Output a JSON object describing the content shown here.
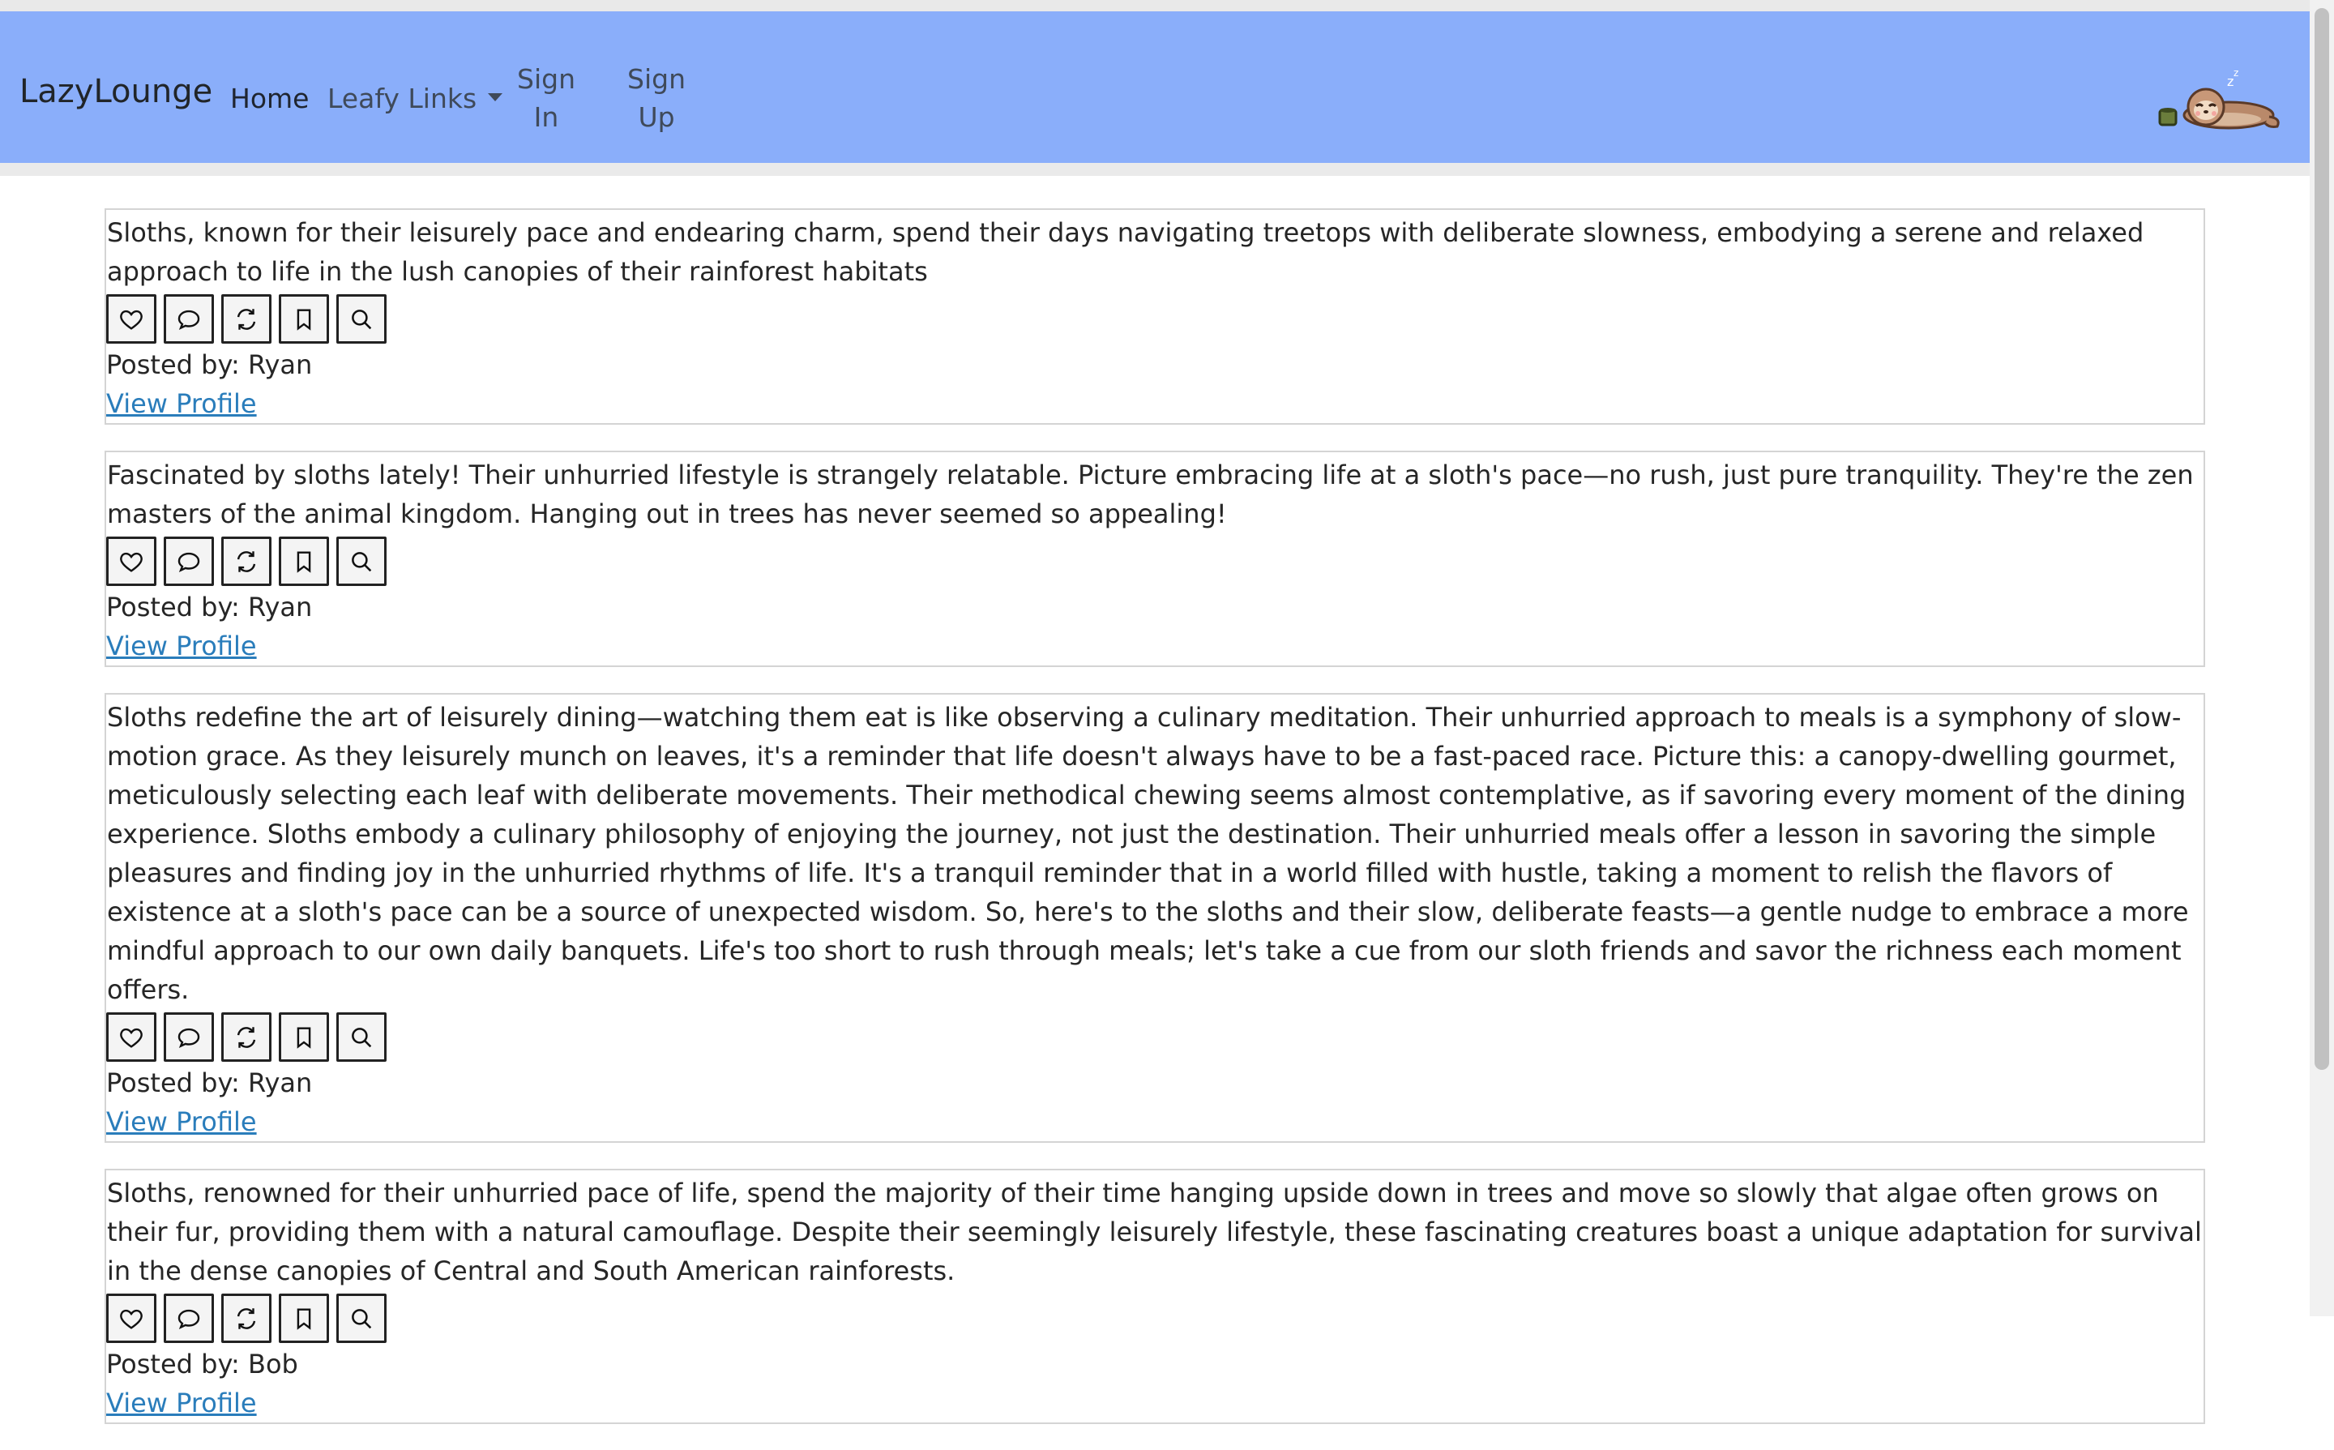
{
  "navbar": {
    "brand": "LazyLounge",
    "links": {
      "home": "Home",
      "leafy": "Leafy Links",
      "sign_in": "Sign In",
      "sign_up": "Sign Up"
    },
    "bg_color": "#8aaefa",
    "logo_icon": "sleeping-sloth-icon"
  },
  "action_icons": [
    "heart-icon",
    "comment-icon",
    "repost-icon",
    "bookmark-icon",
    "search-icon"
  ],
  "posts": [
    {
      "text": "Sloths, known for their leisurely pace and endearing charm, spend their days navigating treetops with deliberate slowness, embodying a serene and relaxed approach to life in the lush canopies of their rainforest habitats",
      "posted_by": "Posted by: Ryan",
      "link": "View Profile"
    },
    {
      "text": "Fascinated by sloths lately! Their unhurried lifestyle is strangely relatable. Picture embracing life at a sloth's pace—no rush, just pure tranquility. They're the zen masters of the animal kingdom. Hanging out in trees has never seemed so appealing!",
      "posted_by": "Posted by: Ryan",
      "link": "View Profile"
    },
    {
      "text": "Sloths redefine the art of leisurely dining—watching them eat is like observing a culinary meditation. Their unhurried approach to meals is a symphony of slow-motion grace. As they leisurely munch on leaves, it's a reminder that life doesn't always have to be a fast-paced race. Picture this: a canopy-dwelling gourmet, meticulously selecting each leaf with deliberate movements. Their methodical chewing seems almost contemplative, as if savoring every moment of the dining experience. Sloths embody a culinary philosophy of enjoying the journey, not just the destination. Their unhurried meals offer a lesson in savoring the simple pleasures and finding joy in the unhurried rhythms of life. It's a tranquil reminder that in a world filled with hustle, taking a moment to relish the flavors of existence at a sloth's pace can be a source of unexpected wisdom. So, here's to the sloths and their slow, deliberate feasts—a gentle nudge to embrace a more mindful approach to our own daily banquets. Life's too short to rush through meals; let's take a cue from our sloth friends and savor the richness each moment offers.",
      "posted_by": "Posted by: Ryan",
      "link": "View Profile"
    },
    {
      "text": "Sloths, renowned for their unhurried pace of life, spend the majority of their time hanging upside down in trees and move so slowly that algae often grows on their fur, providing them with a natural camouflage. Despite their seemingly leisurely lifestyle, these fascinating creatures boast a unique adaptation for survival in the dense canopies of Central and South American rainforests.",
      "posted_by": "Posted by: Bob",
      "link": "View Profile"
    }
  ]
}
